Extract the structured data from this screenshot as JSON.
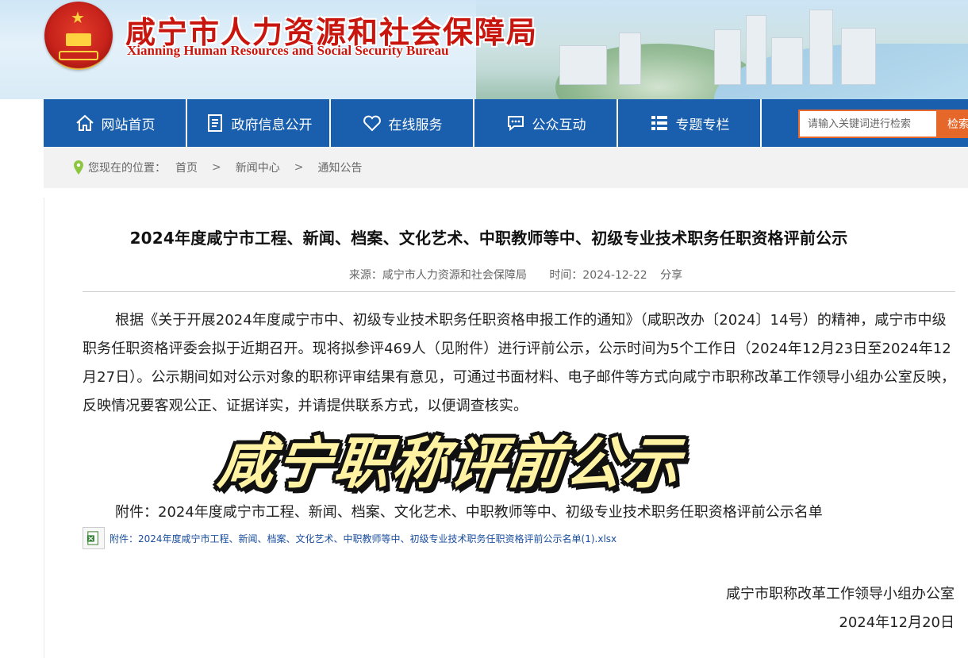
{
  "header": {
    "site_title": "咸宁市人力资源和社会保障局",
    "site_subtitle": "Xianning Human Resources and Social Security Bureau"
  },
  "nav": {
    "items": [
      {
        "label": "网站首页",
        "icon": "home-icon"
      },
      {
        "label": "政府信息公开",
        "icon": "document-icon"
      },
      {
        "label": "在线服务",
        "icon": "heart-icon"
      },
      {
        "label": "公众互动",
        "icon": "chat-icon"
      },
      {
        "label": "专题专栏",
        "icon": "list-icon"
      }
    ],
    "search_placeholder": "请输入关键词进行检索",
    "search_button": "检索"
  },
  "breadcrumb": {
    "prefix": "您现在的位置：",
    "items": [
      "首页",
      "新闻中心",
      "通知公告"
    ],
    "separator": ">"
  },
  "article": {
    "title": "2024年度咸宁市工程、新闻、档案、文化艺术、中职教师等中、初级专业技术职务任职资格评前公示",
    "source_label": "来源：咸宁市人力资源和社会保障局",
    "time_label": "时间：2024-12-22",
    "share_label": "分享",
    "body": "根据《关于开展2024年度咸宁市中、初级专业技术职务任职资格申报工作的通知》（咸职改办〔2024〕14号）的精神，咸宁市中级职务任职资格评委会拟于近期召开。现将拟参评469人（见附件）进行评前公示，公示时间为5个工作日（2024年12月23日至2024年12月27日）。公示期间如对公示对象的职称评审结果有意见，可通过书面材料、电子邮件等方式向咸宁市职称改革工作领导小组办公室反映，反映情况要客观公正、证据详实，并请提供联系方式，以便调查核实。",
    "attachment_text": "附件：2024年度咸宁市工程、新闻、档案、文化艺术、中职教师等中、初级专业技术职务任职资格评前公示名单",
    "attachment_link": "附件：2024年度咸宁市工程、新闻、档案、文化艺术、中职教师等中、初级专业技术职务任职资格评前公示名单(1).xlsx",
    "signature_office": "咸宁市职称改革工作领导小组办公室",
    "signature_date": "2024年12月20日"
  },
  "overlay": {
    "caption": "咸宁职称评前公示"
  },
  "colors": {
    "nav_blue": "#1a5fae",
    "search_orange": "#e5672a",
    "title_red": "#c8160e",
    "link_blue": "#1a4fa0"
  }
}
